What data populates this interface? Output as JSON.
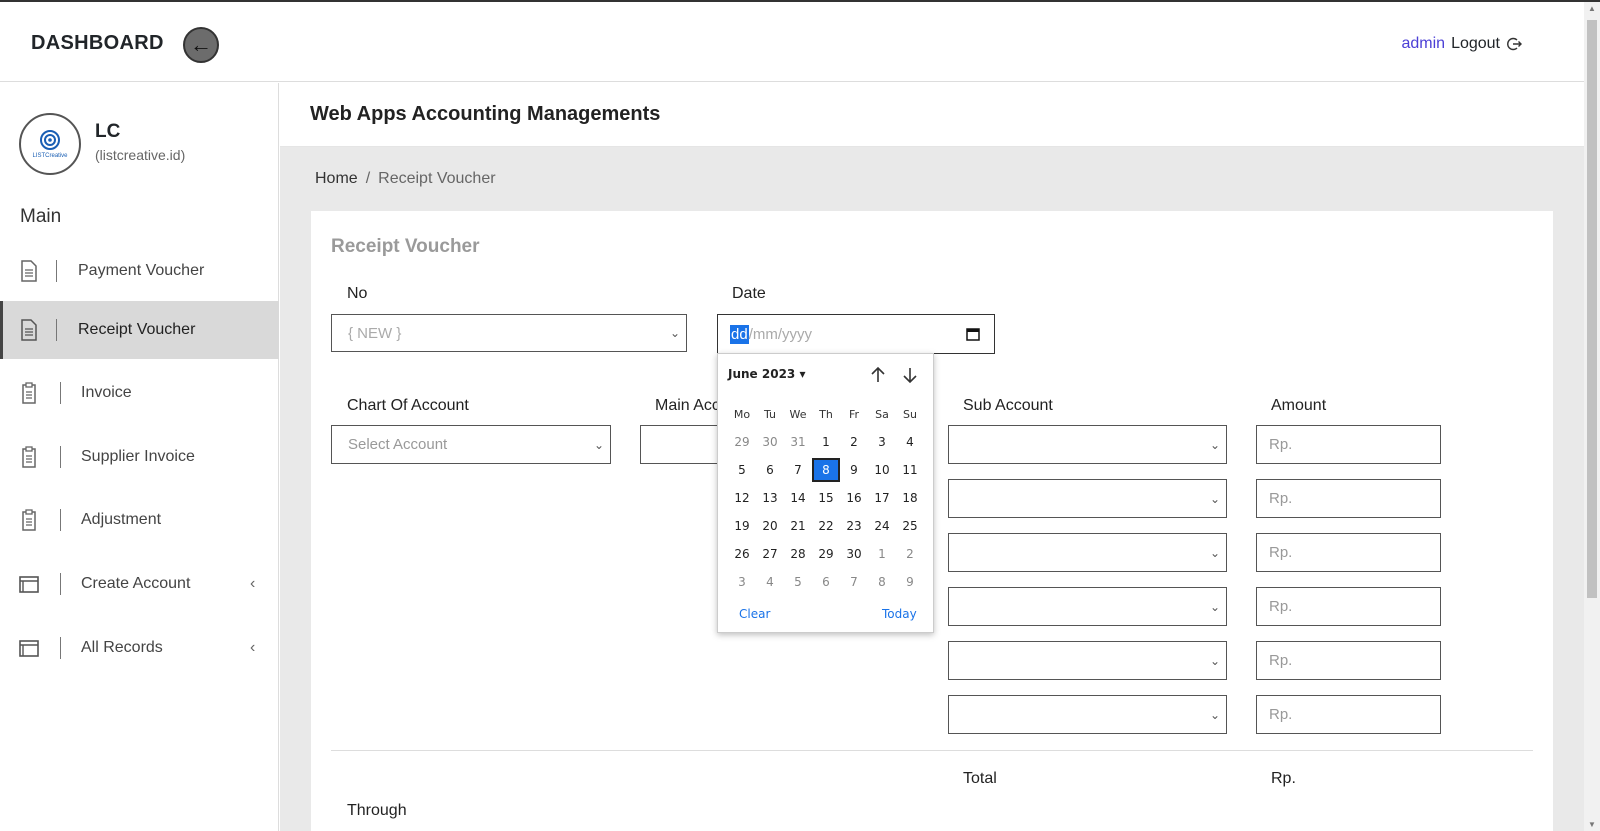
{
  "topbar": {
    "brand": "DASHBOARD",
    "user": "admin",
    "logout": "Logout"
  },
  "sidebar": {
    "org_name": "LC",
    "org_sub": "(listcreative.id)",
    "logo_text": "LISTCreative",
    "section": "Main",
    "items": [
      {
        "label": "Payment Voucher",
        "icon": "document-icon"
      },
      {
        "label": "Receipt Voucher",
        "icon": "document-icon",
        "active": true
      },
      {
        "label": "Invoice",
        "icon": "clipboard-icon"
      },
      {
        "label": "Supplier Invoice",
        "icon": "clipboard-icon"
      },
      {
        "label": "Adjustment",
        "icon": "clipboard-icon"
      },
      {
        "label": "Create Account",
        "icon": "window-icon",
        "chevron": "‹"
      },
      {
        "label": "All Records",
        "icon": "window-icon",
        "chevron": "‹"
      }
    ]
  },
  "header": {
    "title": "Web Apps Accounting Managements"
  },
  "breadcrumb": {
    "home": "Home",
    "separator": "/",
    "current": "Receipt Voucher"
  },
  "form": {
    "title": "Receipt Voucher",
    "no_label": "No",
    "no_value": "{ NEW }",
    "date_label": "Date",
    "date_dd": "dd",
    "date_rest": "/mm/yyyy",
    "chart_label": "Chart Of Account",
    "chart_placeholder": "Select Account",
    "main_label": "Main Acc",
    "sub_label": "Sub Account",
    "amount_label": "Amount",
    "amount_placeholder": "Rp.",
    "total_label": "Total",
    "total_value": "Rp.",
    "through_label": "Through"
  },
  "datepicker": {
    "month": "June 2023",
    "weekdays": [
      "Mo",
      "Tu",
      "We",
      "Th",
      "Fr",
      "Sa",
      "Su"
    ],
    "weeks": [
      [
        "29",
        "30",
        "31",
        "1",
        "2",
        "3",
        "4"
      ],
      [
        "5",
        "6",
        "7",
        "8",
        "9",
        "10",
        "11"
      ],
      [
        "12",
        "13",
        "14",
        "15",
        "16",
        "17",
        "18"
      ],
      [
        "19",
        "20",
        "21",
        "22",
        "23",
        "24",
        "25"
      ],
      [
        "26",
        "27",
        "28",
        "29",
        "30",
        "1",
        "2"
      ],
      [
        "3",
        "4",
        "5",
        "6",
        "7",
        "8",
        "9"
      ]
    ],
    "selected": "8",
    "clear": "Clear",
    "today": "Today"
  },
  "colors": {
    "accent": "#1a73e8",
    "admin_link": "#4b3fd6",
    "active_bg": "#d9d9d9",
    "content_bg": "#e9e9e9"
  }
}
